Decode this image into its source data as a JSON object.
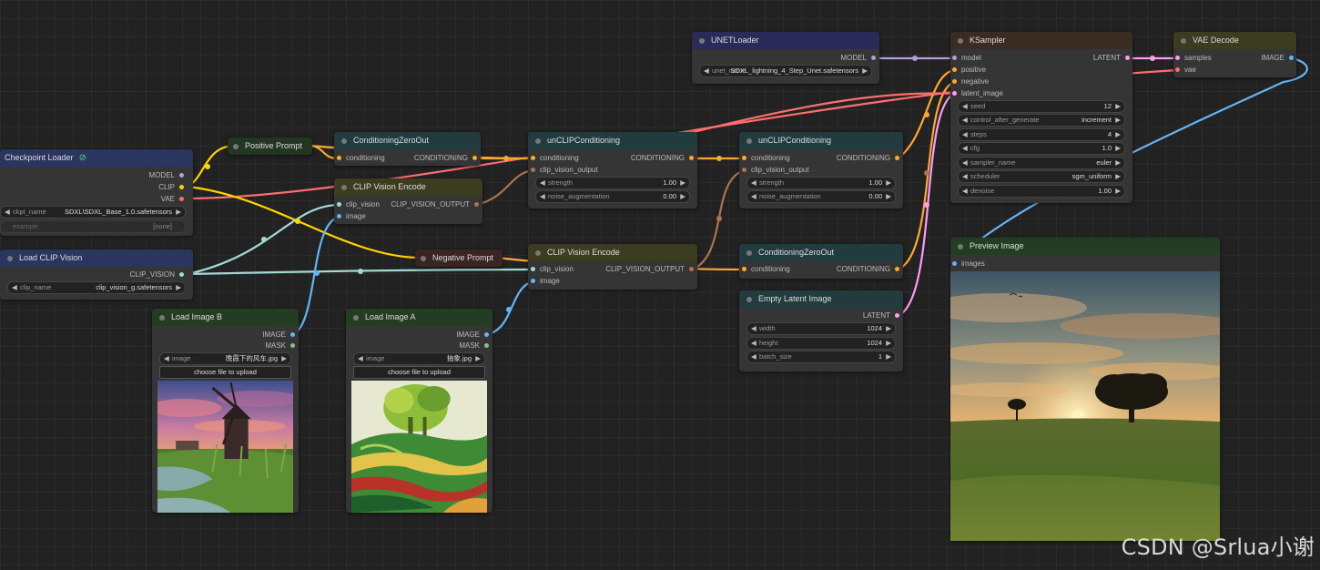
{
  "colors": {
    "model": "#b39ddb",
    "clip": "#ffd500",
    "vae": "#ff6e6e",
    "conditioning": "#ffa931",
    "clip_vision": "#a1dbd5",
    "clip_vision_output": "#ad7452",
    "image": "#64b5f6",
    "mask": "#81c784",
    "latent": "#ff9cf9"
  },
  "nodes": {
    "checkpoint_loader": {
      "title": "Checkpoint Loader",
      "outputs": [
        "MODEL",
        "CLIP",
        "VAE"
      ],
      "ckpt_name_label": "ckpt_name",
      "ckpt_name_value": "SDXL\\SDXL_Base_1.0.safetensors",
      "example_label": "example",
      "example_value": "[none]"
    },
    "load_clip_vision": {
      "title": "Load CLIP Vision",
      "output": "CLIP_VISION",
      "clip_name_label": "clip_name",
      "clip_name_value": "clip_vision_g.safetensors"
    },
    "positive_prompt": {
      "title": "Positive Prompt"
    },
    "negative_prompt": {
      "title": "Negative Prompt"
    },
    "conditioning_zero_out_1": {
      "title": "ConditioningZeroOut",
      "input": "conditioning",
      "output": "CONDITIONING"
    },
    "clip_vision_encode_1": {
      "title": "CLIP Vision Encode",
      "inputs": [
        "clip_vision",
        "image"
      ],
      "output": "CLIP_VISION_OUTPUT"
    },
    "load_image_b": {
      "title": "Load Image B",
      "outputs": [
        "IMAGE",
        "MASK"
      ],
      "image_label": "image",
      "image_value": "晚霞下的风车.jpg",
      "upload_label": "choose file to upload"
    },
    "load_image_a": {
      "title": "Load Image A",
      "outputs": [
        "IMAGE",
        "MASK"
      ],
      "image_label": "image",
      "image_value": "抽象.jpg",
      "upload_label": "choose file to upload"
    },
    "unclip_conditioning_1": {
      "title": "unCLIPConditioning",
      "inputs": [
        "conditioning",
        "clip_vision_output"
      ],
      "output": "CONDITIONING",
      "strength_label": "strength",
      "strength_value": "1.00",
      "noise_label": "noise_augmentation",
      "noise_value": "0.00"
    },
    "clip_vision_encode_2": {
      "title": "CLIP Vision Encode",
      "inputs": [
        "clip_vision",
        "image"
      ],
      "output": "CLIP_VISION_OUTPUT"
    },
    "unet_loader": {
      "title": "UNETLoader",
      "output": "MODEL",
      "unet_label": "unet_name",
      "unet_value": "SDXL_lightning_4_Step_Unet.safetensors"
    },
    "unclip_conditioning_2": {
      "title": "unCLIPConditioning",
      "inputs": [
        "conditioning",
        "clip_vision_output"
      ],
      "output": "CONDITIONING",
      "strength_label": "strength",
      "strength_value": "1.00",
      "noise_label": "noise_augmentation",
      "noise_value": "0.00"
    },
    "conditioning_zero_out_2": {
      "title": "ConditioningZeroOut",
      "input": "conditioning",
      "output": "CONDITIONING"
    },
    "empty_latent_image": {
      "title": "Empty Latent Image",
      "output": "LATENT",
      "width_label": "width",
      "width_value": "1024",
      "height_label": "height",
      "height_value": "1024",
      "batch_label": "batch_size",
      "batch_value": "1"
    },
    "ksampler": {
      "title": "KSampler",
      "inputs": [
        "model",
        "positive",
        "negative",
        "latent_image"
      ],
      "output": "LATENT",
      "widgets": [
        {
          "label": "seed",
          "value": "12"
        },
        {
          "label": "control_after_generate",
          "value": "increment"
        },
        {
          "label": "steps",
          "value": "4"
        },
        {
          "label": "cfg",
          "value": "1.0"
        },
        {
          "label": "sampler_name",
          "value": "euler"
        },
        {
          "label": "scheduler",
          "value": "sgm_uniform"
        },
        {
          "label": "denoise",
          "value": "1.00"
        }
      ]
    },
    "vae_decode": {
      "title": "VAE Decode",
      "inputs": [
        "samples",
        "vae"
      ],
      "output": "IMAGE"
    },
    "preview_image": {
      "title": "Preview Image",
      "input": "images"
    }
  },
  "watermark": "CSDN @Srlua小谢"
}
